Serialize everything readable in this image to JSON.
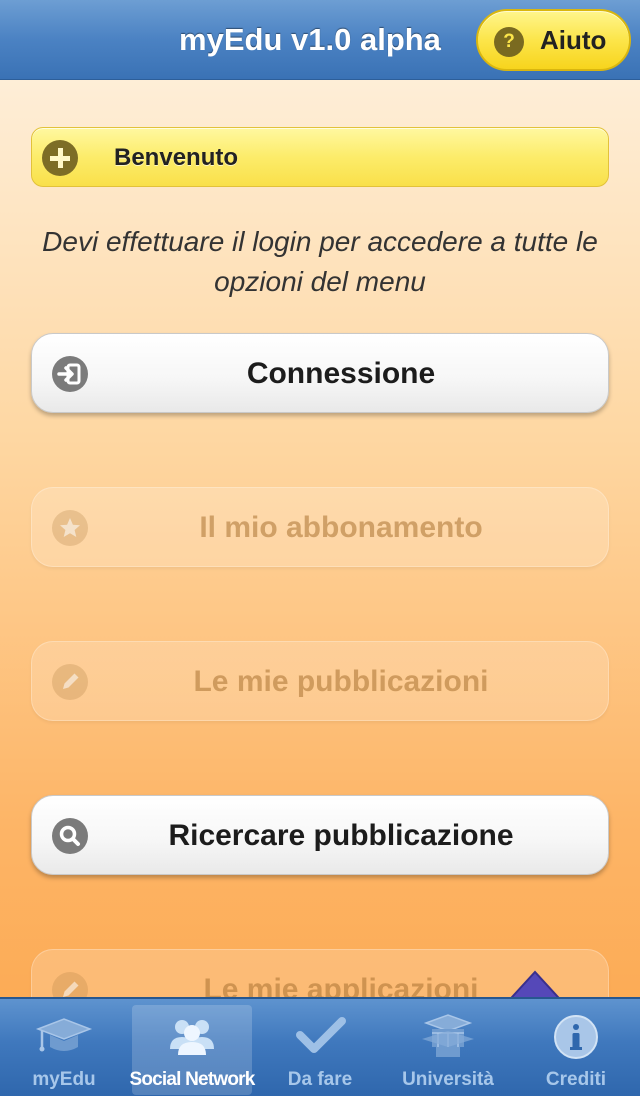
{
  "header": {
    "title": "myEdu v1.0 alpha",
    "help_label": "Aiuto",
    "help_icon": "?"
  },
  "welcome": {
    "label": "Benvenuto",
    "icon": "plus-icon"
  },
  "login_message": "Devi effettuare il login per accedere a tutte le opzioni del menu",
  "menu": [
    {
      "label": "Connessione",
      "icon": "login-icon",
      "enabled": true
    },
    {
      "label": "Il mio abbonamento",
      "icon": "star-icon",
      "enabled": false
    },
    {
      "label": "Le mie pubblicazioni",
      "icon": "pencil-icon",
      "enabled": false
    },
    {
      "label": "Ricercare pubblicazione",
      "icon": "search-icon",
      "enabled": true
    },
    {
      "label": "Le mie applicazioni",
      "icon": "pencil-icon",
      "enabled": false
    }
  ],
  "tabs": [
    {
      "label": "myEdu",
      "icon": "graduation-cap-icon",
      "active": false
    },
    {
      "label": "Social Network",
      "icon": "people-icon",
      "active": true
    },
    {
      "label": "Da fare",
      "icon": "checkmark-icon",
      "active": false
    },
    {
      "label": "Università",
      "icon": "university-icon",
      "active": false
    },
    {
      "label": "Crediti",
      "icon": "info-icon",
      "active": false
    }
  ],
  "colors": {
    "navbar": "#4b82c3",
    "help_button": "#fce54a",
    "welcome_bar": "#fcec6a",
    "background_top": "#fef3e3",
    "background_bottom": "#fca64c",
    "tabbar": "#3f78bd"
  }
}
